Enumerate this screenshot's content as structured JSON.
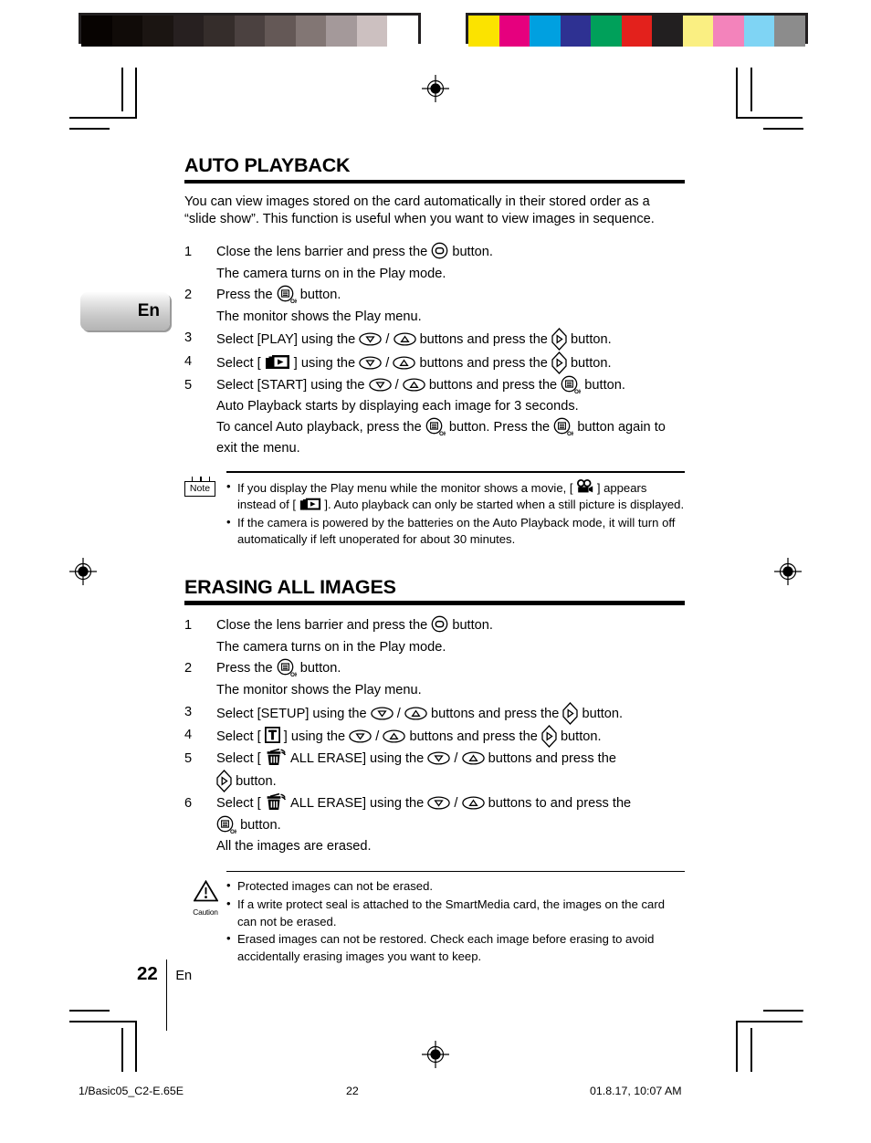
{
  "calibration": {
    "gray_bar_name": "grayscale-step-wedge",
    "gray_swatches": [
      "#070301",
      "#100b08",
      "#1b1512",
      "#272020",
      "#352d2b",
      "#4b4140",
      "#645856",
      "#827674",
      "#a4999a",
      "#ccc0c0",
      "#ffffff"
    ],
    "color_bar_name": "color-control-patches",
    "color_swatches": [
      "#fbe300",
      "#e6007e",
      "#00a0e0",
      "#2e3192",
      "#00a05a",
      "#e3211c",
      "#221f20",
      "#faef82",
      "#f383bb",
      "#7fd4f4",
      "#8c8c8c"
    ]
  },
  "side_tab": {
    "label": "En"
  },
  "sections": [
    {
      "id": "auto-playback",
      "title": "AUTO PLAYBACK",
      "intro": "You can view images stored on the card automatically in their stored order as a “slide show”. This function is useful when you want to view images in sequence.",
      "steps": [
        {
          "num": "1",
          "text_a": "Close the lens barrier and press the",
          "icons": [
            "monitor-button-icon"
          ],
          "text_b": "button.",
          "note": "The camera turns on in the Play mode."
        },
        {
          "num": "2",
          "text_a": "Press the",
          "icons": [
            "menu-ok-button-icon"
          ],
          "text_b": "button.",
          "note": "The monitor shows the Play menu."
        },
        {
          "num": "3",
          "text_a": "Select [PLAY] using the",
          "text_mid": "buttons and press the",
          "text_b": "button."
        },
        {
          "num": "4",
          "text_a": "Select [",
          "text_mid": "] using the",
          "text_mid2": "buttons and press the",
          "text_b": "button."
        },
        {
          "num": "5",
          "text_a": "Select [START] using the",
          "text_mid": "buttons and press the",
          "text_b": "button."
        }
      ],
      "after_steps": [
        "Auto Playback starts by displaying each image for 3 seconds.",
        "exit the menu."
      ],
      "cancel_line": {
        "a": "To cancel Auto playback, press the",
        "b": "button. Press the",
        "c": "button again to"
      },
      "callout": {
        "type": "note",
        "badge_label": "Note",
        "bullets": [
          {
            "a": "If you display the Play menu while the monitor shows a movie, [",
            "b": "] appears instead of [",
            "c": "]. Auto playback can only be started when a still picture is displayed."
          },
          {
            "a": "If the camera is powered by the batteries on the Auto Playback mode, it will turn off automatically if left unoperated for about 30 minutes."
          }
        ]
      }
    },
    {
      "id": "erasing-all-images",
      "title": "ERASING ALL IMAGES",
      "steps": [
        {
          "num": "1",
          "text_a": "Close the lens barrier and press the",
          "text_b": "button.",
          "note": "The camera turns on in the Play mode."
        },
        {
          "num": "2",
          "text_a": "Press the",
          "text_b": "button.",
          "note": "The monitor shows the Play menu."
        },
        {
          "num": "3",
          "text_a": "Select [SETUP] using the",
          "text_mid": "buttons and press the",
          "text_b": "button."
        },
        {
          "num": "4",
          "text_a": "Select [",
          "text_mid": "] using the",
          "text_mid2": "buttons and press the",
          "text_b": "button."
        },
        {
          "num": "5",
          "text_a": "Select [",
          "text_mid": "ALL ERASE]  using the",
          "text_mid2": "buttons and press the",
          "text_b": "button."
        },
        {
          "num": "6",
          "text_a": "Select [",
          "text_mid": "ALL ERASE] using the",
          "text_mid2": "buttons to and press the",
          "text_b": "button.",
          "note": "All the images are erased."
        }
      ],
      "callout": {
        "type": "caution",
        "badge_label": "Caution",
        "bullets": [
          {
            "a": "Protected images can not be erased."
          },
          {
            "a": "If a write protect seal is attached to the SmartMedia card, the images on the card can not be erased."
          },
          {
            "a": "Erased images can not be restored. Check each image before erasing to avoid accidentally erasing images you want to keep."
          }
        ]
      }
    }
  ],
  "page_marker": {
    "number": "22",
    "language": "En"
  },
  "footer": {
    "left": "1/Basic05_C2-E.65E",
    "middle": "22",
    "right": "01.8.17, 10:07 AM"
  }
}
